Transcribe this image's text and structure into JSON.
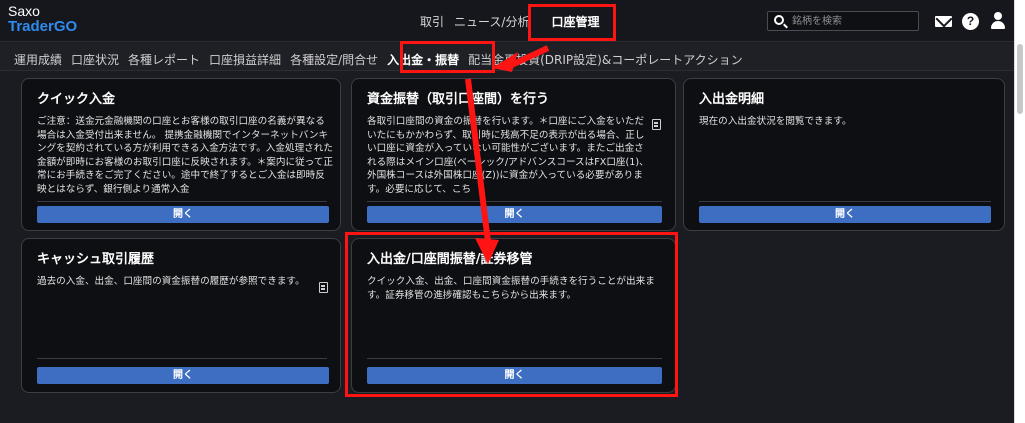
{
  "brand": {
    "line1": "Saxo",
    "line2": "TraderGO"
  },
  "main_nav": {
    "items": [
      "取引",
      "ニュース/分析"
    ],
    "active": "口座管理"
  },
  "search": {
    "placeholder": "銘柄を検索"
  },
  "sub_nav": {
    "items": [
      "運用成績",
      "口座状況",
      "各種レポート",
      "口座損益詳細",
      "各種設定/問合せ"
    ],
    "active": "入出金・振替",
    "after": "配当金再投資(DRIP設定)&コーポレートアクション"
  },
  "cards": [
    {
      "title": "クイック入金",
      "desc": "ご注意：送金元金融機関の口座とお客様の取引口座の名義が異なる場合は入金受付出来ません。 提携金融機関でインターネットバンキングを契約されている方が利用できる入金方法です。入金処理された金額が即時にお客様のお取引口座に反映されます。＊案内に従って正常にお手続きをご完了ください。途中で終了するとご入金は即時反映とはならず、銀行側より通常入金",
      "button": "開く"
    },
    {
      "title": "資金振替（取引口座間）を行う",
      "desc": "各取引口座間の資金の振替を行います。＊口座にご入金をいただいたにもかかわらず、取引時に残高不足の表示が出る場合、正しい口座に資金が入っていない可能性がございます。またご出金される際はメイン口座(ベーシック/アドバンスコースはFX口座(1)、外国株コースは外国株口座(Z))に資金が入っている必要があります。必要に応じて、こち",
      "button": "開く"
    },
    {
      "title": "入出金明細",
      "desc": "現在の入出金状況を閲覧できます。",
      "button": "開く"
    },
    {
      "title": "キャッシュ取引履歴",
      "desc": "過去の入金、出金、口座間の資金振替の履歴が参照できます。",
      "button": "開く"
    },
    {
      "title": "入出金/口座間振替/証券移管",
      "desc": "クイック入金、出金、口座間資金振替の手続きを行うことが出来ます。証券移管の進捗確認もこちらから出来ます。",
      "button": "開く"
    }
  ],
  "colors": {
    "accent_button": "#3e6ec2",
    "annotation": "#ff1414",
    "brand_blue": "#2d8cf0"
  }
}
